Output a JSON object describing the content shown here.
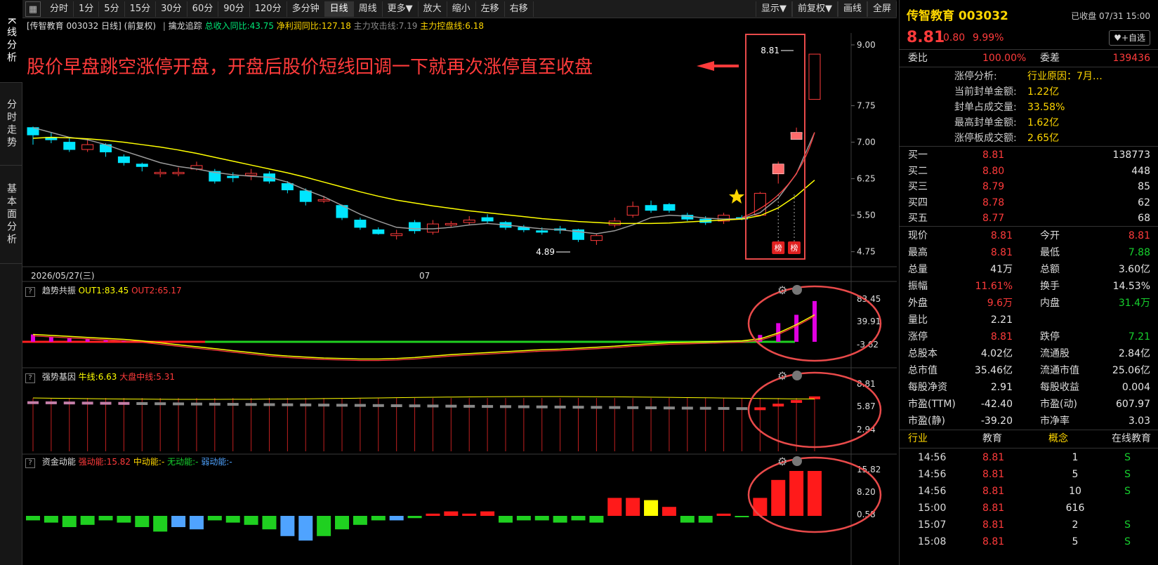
{
  "sidebar": {
    "tabs": [
      {
        "label": "K线分析"
      },
      {
        "label": "分时走势"
      },
      {
        "label": "基本面分析"
      }
    ]
  },
  "toolbar": {
    "periods": [
      "分时",
      "1分",
      "5分",
      "15分",
      "30分",
      "60分",
      "90分",
      "120分",
      "多分钟",
      "日线",
      "周线",
      "更多▼",
      "放大",
      "缩小",
      "左移",
      "右移"
    ],
    "active": "日线",
    "right": [
      "显示▼",
      "前复权▼",
      "画线",
      "全屏"
    ]
  },
  "infobar": {
    "stock": "[传智教育 003032 日线]",
    "adj": "(前复权)",
    "indicator": "擒龙追踪",
    "m1": "总收入同比:43.75",
    "m2": "净利润同比:127.18",
    "m3": "主力攻击线:7.19",
    "m4": "主力控盘线:6.18"
  },
  "annotation": "股价早盘跳空涨停开盘，开盘后股价短线回调一下就再次涨停直至收盘",
  "main_chart": {
    "y_ticks": [
      "9.00",
      "7.75",
      "7.00",
      "6.25",
      "5.50",
      "4.75"
    ],
    "date_label": "2026/05/27(三)",
    "month_label": "07",
    "low_label": "4.89",
    "high_label": "8.81",
    "bang": "榜"
  },
  "panel1": {
    "name": "趋势共振",
    "s1": "OUT1:83.45",
    "s2": "OUT2:65.17",
    "ticks": [
      "83.45",
      "39.91",
      "-3.62"
    ]
  },
  "panel2": {
    "name": "强势基因",
    "s1": "牛线:6.63",
    "s2": "大盘中线:5.31",
    "ticks": [
      "8.81",
      "5.87",
      "2.94"
    ]
  },
  "panel3": {
    "name": "资金动能",
    "s1": "强动能:15.82",
    "s2": "中动能:-",
    "s3": "无动能:-",
    "s4": "弱动能:-",
    "ticks": [
      "15.82",
      "8.20",
      "0.58"
    ]
  },
  "colors": {
    "up": "#ff3b3b",
    "down": "#00e5ff",
    "ma_yellow": "#ffff00",
    "ma_gray": "#9a9a9a",
    "accent_red": "#e84a4a"
  },
  "chart_data": {
    "type": "candlestick",
    "y_range": [
      4.6,
      9.1
    ],
    "candles": [
      [
        7.3,
        7.15,
        7.32,
        6.95
      ],
      [
        7.1,
        7.05,
        7.2,
        6.98
      ],
      [
        7.0,
        6.85,
        7.1,
        6.8
      ],
      [
        6.85,
        6.95,
        7.05,
        6.8
      ],
      [
        6.95,
        6.8,
        6.98,
        6.7
      ],
      [
        6.7,
        6.58,
        6.75,
        6.52
      ],
      [
        6.55,
        6.5,
        6.58,
        6.4
      ],
      [
        6.38,
        6.38,
        6.45,
        6.28
      ],
      [
        6.38,
        6.38,
        6.48,
        6.3
      ],
      [
        6.45,
        6.52,
        6.6,
        6.42
      ],
      [
        6.4,
        6.2,
        6.45,
        6.15
      ],
      [
        6.3,
        6.28,
        6.38,
        6.18
      ],
      [
        6.32,
        6.36,
        6.45,
        6.22
      ],
      [
        6.35,
        6.2,
        6.4,
        6.15
      ],
      [
        6.15,
        6.02,
        6.2,
        5.95
      ],
      [
        6.0,
        5.78,
        6.05,
        5.7
      ],
      [
        5.8,
        5.82,
        5.9,
        5.75
      ],
      [
        5.7,
        5.45,
        5.72,
        5.4
      ],
      [
        5.4,
        5.25,
        5.45,
        5.2
      ],
      [
        5.2,
        5.12,
        5.25,
        5.1
      ],
      [
        5.08,
        5.12,
        5.2,
        5.0
      ],
      [
        5.35,
        5.18,
        5.4,
        5.12
      ],
      [
        5.15,
        5.32,
        5.4,
        5.1
      ],
      [
        5.3,
        5.33,
        5.38,
        5.25
      ],
      [
        5.35,
        5.4,
        5.48,
        5.3
      ],
      [
        5.45,
        5.38,
        5.52,
        5.32
      ],
      [
        5.35,
        5.25,
        5.38,
        5.2
      ],
      [
        5.25,
        5.2,
        5.3,
        5.15
      ],
      [
        5.18,
        5.15,
        5.25,
        5.1
      ],
      [
        5.22,
        5.2,
        5.28,
        5.12
      ],
      [
        5.2,
        5.0,
        5.22,
        4.95
      ],
      [
        4.98,
        5.08,
        5.12,
        4.89
      ],
      [
        5.3,
        5.38,
        5.45,
        5.25
      ],
      [
        5.5,
        5.68,
        5.78,
        5.45
      ],
      [
        5.7,
        5.6,
        5.8,
        5.55
      ],
      [
        5.72,
        5.6,
        5.75,
        5.55
      ],
      [
        5.5,
        5.42,
        5.55,
        5.38
      ],
      [
        5.42,
        5.35,
        5.48,
        5.3
      ],
      [
        5.38,
        5.5,
        5.55,
        5.32
      ],
      [
        5.45,
        5.42,
        5.5,
        5.4
      ],
      [
        5.5,
        5.95,
        5.98,
        5.48
      ],
      [
        6.35,
        6.55,
        6.6,
        6.15
      ],
      [
        7.2,
        7.2,
        7.3,
        7.1
      ],
      [
        7.88,
        8.81,
        8.81,
        7.88
      ]
    ],
    "ma_yellow": [
      7.08,
      7.1,
      7.09,
      7.07,
      7.04,
      7.0,
      6.95,
      6.9,
      6.84,
      6.77,
      6.69,
      6.61,
      6.53,
      6.45,
      6.37,
      6.28,
      6.18,
      6.08,
      5.98,
      5.89,
      5.81,
      5.75,
      5.69,
      5.64,
      5.59,
      5.55,
      5.51,
      5.47,
      5.43,
      5.4,
      5.37,
      5.35,
      5.33,
      5.33,
      5.33,
      5.34,
      5.36,
      5.38,
      5.4,
      5.42,
      5.49,
      5.65,
      5.9,
      6.22
    ],
    "ma_gray": [
      7.3,
      7.2,
      7.1,
      7.05,
      6.95,
      6.82,
      6.7,
      6.58,
      6.5,
      6.45,
      6.38,
      6.33,
      6.3,
      6.28,
      6.18,
      6.02,
      5.88,
      5.7,
      5.52,
      5.38,
      5.25,
      5.22,
      5.22,
      5.25,
      5.3,
      5.33,
      5.3,
      5.26,
      5.22,
      5.2,
      5.16,
      5.12,
      5.18,
      5.3,
      5.45,
      5.5,
      5.48,
      5.44,
      5.42,
      5.43,
      5.55,
      5.85,
      6.35,
      7.2
    ],
    "panel1_bars": [
      15,
      10,
      7,
      5,
      3,
      2,
      0,
      0,
      0,
      0,
      0,
      0,
      0,
      0,
      0,
      0,
      0,
      0,
      0,
      0,
      0,
      0,
      0,
      0,
      0,
      0,
      0,
      0,
      0,
      0,
      0,
      0,
      0,
      0,
      0,
      0,
      0,
      0,
      0,
      0,
      14,
      38,
      55,
      83
    ],
    "panel3_bars": [
      -2,
      -3,
      -5,
      -4,
      -2,
      -3,
      -5,
      -7,
      -5,
      -6,
      -2,
      -3,
      -4,
      -6,
      -9,
      -11,
      -9,
      -6,
      -4,
      -2,
      -2,
      -1,
      1,
      2,
      1,
      2,
      -3,
      -2,
      -2,
      -3,
      -2,
      -3,
      8,
      8,
      7,
      4,
      -3,
      -3,
      1,
      0,
      8,
      16,
      20,
      20
    ]
  },
  "right_panel": {
    "title": "传智教育 003032",
    "status": "已收盘 07/31 15:00",
    "price": "8.81",
    "change": "0.80",
    "pct": "9.99%",
    "add": "+自选",
    "wb": {
      "l1": "委比",
      "v1": "100.00%",
      "l2": "委差",
      "v2": "139436"
    },
    "limit": [
      {
        "l": "涨停分析:",
        "v": "行业原因：7月…"
      },
      {
        "l": "当前封单金额:",
        "v": "1.22亿"
      },
      {
        "l": "封单占成交量:",
        "v": "33.58%"
      },
      {
        "l": "最高封单金额:",
        "v": "1.62亿"
      },
      {
        "l": "涨停板成交额:",
        "v": "2.65亿"
      }
    ],
    "bids": [
      [
        "买一",
        "8.81",
        "138773"
      ],
      [
        "买二",
        "8.80",
        "448"
      ],
      [
        "买三",
        "8.79",
        "85"
      ],
      [
        "买四",
        "8.78",
        "62"
      ],
      [
        "买五",
        "8.77",
        "68"
      ]
    ],
    "stats": [
      [
        "现价",
        "8.81",
        "今开",
        "8.81"
      ],
      [
        "最高",
        "8.81",
        "最低",
        "7.88"
      ],
      [
        "总量",
        "41万",
        "总额",
        "3.60亿"
      ],
      [
        "振幅",
        "11.61%",
        "换手",
        "14.53%"
      ],
      [
        "外盘",
        "9.6万",
        "内盘",
        "31.4万"
      ],
      [
        "量比",
        "2.21",
        "",
        ""
      ],
      [
        "涨停",
        "8.81",
        "跌停",
        "7.21"
      ],
      [
        "总股本",
        "4.02亿",
        "流通股",
        "2.84亿"
      ],
      [
        "总市值",
        "35.46亿",
        "流通市值",
        "25.06亿"
      ],
      [
        "每股净资",
        "2.91",
        "每股收益",
        "0.004"
      ],
      [
        "市盈(TTM)",
        "-42.40",
        "市盈(动)",
        "607.97"
      ],
      [
        "市盈(静)",
        "-39.20",
        "市净率",
        "3.03"
      ]
    ],
    "industry": {
      "l1": "行业",
      "v1": "教育",
      "l2": "概念",
      "v2": "在线教育"
    },
    "ticks": [
      [
        "14:56",
        "8.81",
        "1",
        "S"
      ],
      [
        "14:56",
        "8.81",
        "5",
        "S"
      ],
      [
        "14:56",
        "8.81",
        "10",
        "S"
      ],
      [
        "15:00",
        "8.81",
        "616",
        ""
      ],
      [
        "15:07",
        "8.81",
        "2",
        "S"
      ],
      [
        "15:08",
        "8.81",
        "5",
        "S"
      ]
    ]
  }
}
